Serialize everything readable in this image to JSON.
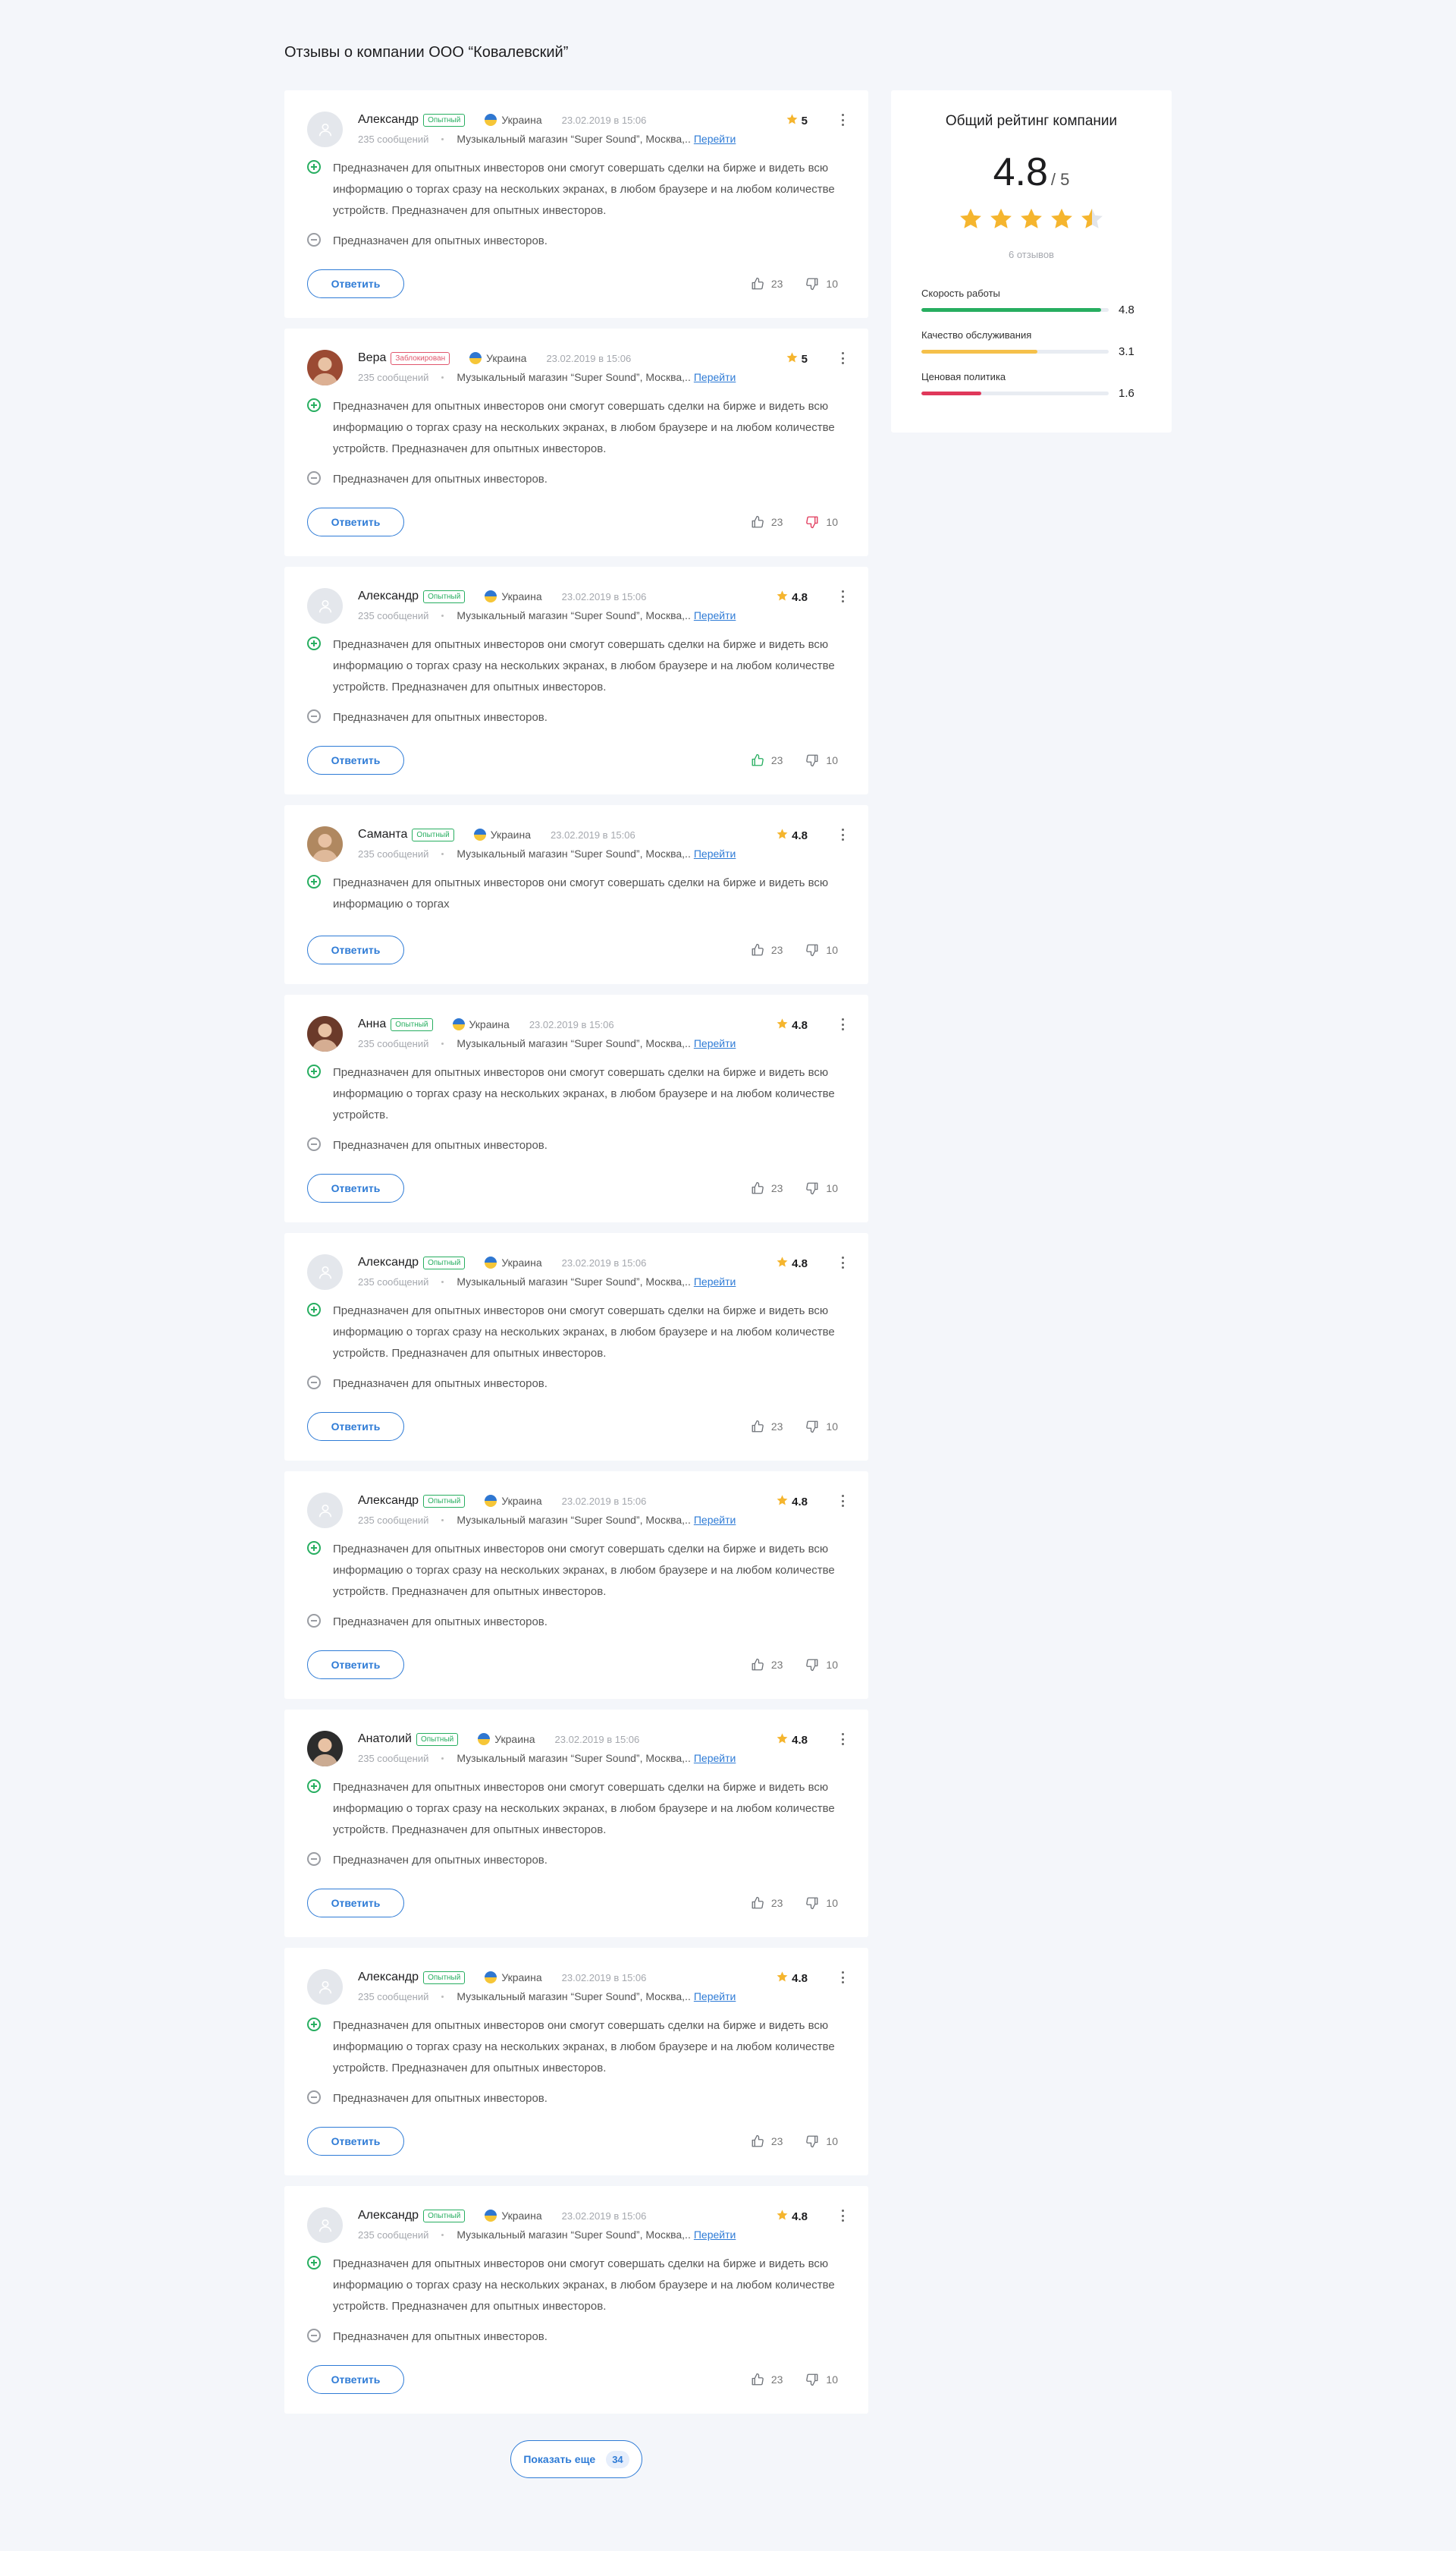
{
  "page_title": "Отзывы о компании ООО “Ковалевский”",
  "summary": {
    "title": "Общий рейтинг компании",
    "score": "4.8",
    "out_of": "/ 5",
    "star_value": 4.5,
    "reviews_count": "6 отзывов",
    "metrics": [
      {
        "label": "Скорость работы",
        "value": "4.8",
        "fraction": 0.96,
        "color": "#27ae60"
      },
      {
        "label": "Качество обслуживания",
        "value": "3.1",
        "fraction": 0.62,
        "color": "#f5c04a"
      },
      {
        "label": "Ценовая политика",
        "value": "1.6",
        "fraction": 0.32,
        "color": "#e0385a"
      }
    ]
  },
  "reply_label": "Ответить",
  "show_more": {
    "label": "Показать еще",
    "count": "34"
  },
  "colors": {
    "accent": "#2e7bd6",
    "positive": "#27ae60",
    "negative": "#e0385a",
    "star": "#f5b52e"
  },
  "reviews": [
    {
      "name": "Александр",
      "badge": "Опытный",
      "country": "Украина",
      "date": "23.02.2019 в 15:06",
      "messages": "235 сообщений",
      "shop": "Музыкальный магазин “Super Sound”, Москва,..",
      "link": "Перейти",
      "rating": "5",
      "pros": "Предназначен для опытных инвесторов они смогут совершать сделки на бирже и видеть всю информацию о торгах сразу на нескольких экранах, в любом браузере и на любом количестве устройств. Предназначен для опытных инвесторов.",
      "cons": "Предназначен для опытных инвесторов.",
      "likes": "23",
      "dislikes": "10"
    },
    {
      "name": "Вера",
      "badge": "Заблокирован",
      "country": "Украина",
      "date": "23.02.2019 в 15:06",
      "messages": "235 сообщений",
      "shop": "Музыкальный магазин “Super Sound”, Москва,..",
      "link": "Перейти",
      "rating": "5",
      "pros": "Предназначен для опытных инвесторов они смогут совершать сделки на бирже и видеть всю информацию о торгах сразу на нескольких экранах, в любом браузере и на любом количестве устройств. Предназначен для опытных инвесторов.",
      "cons": "Предназначен для опытных инвесторов.",
      "likes": "23",
      "dislikes": "10"
    },
    {
      "name": "Александр",
      "badge": "Опытный",
      "country": "Украина",
      "date": "23.02.2019 в 15:06",
      "messages": "235 сообщений",
      "shop": "Музыкальный магазин “Super Sound”, Москва,..",
      "link": "Перейти",
      "rating": "4.8",
      "pros": "Предназначен для опытных инвесторов они смогут совершать сделки на бирже и видеть всю информацию о торгах сразу на нескольких экранах, в любом браузере и на любом количестве устройств. Предназначен для опытных инвесторов.",
      "cons": "Предназначен для опытных инвесторов.",
      "likes": "23",
      "dislikes": "10"
    },
    {
      "name": "Саманта",
      "badge": "Опытный",
      "country": "Украина",
      "date": "23.02.2019 в 15:06",
      "messages": "235 сообщений",
      "shop": "Музыкальный магазин “Super Sound”, Москва,..",
      "link": "Перейти",
      "rating": "4.8",
      "pros": "Предназначен для опытных инвесторов они смогут совершать сделки на бирже и видеть всю информацию о торгах",
      "likes": "23",
      "dislikes": "10"
    },
    {
      "name": "Анна",
      "badge": "Опытный",
      "country": "Украина",
      "date": "23.02.2019 в 15:06",
      "messages": "235 сообщений",
      "shop": "Музыкальный магазин “Super Sound”, Москва,..",
      "link": "Перейти",
      "rating": "4.8",
      "pros": "Предназначен для опытных инвесторов они смогут совершать сделки на бирже и видеть всю информацию о торгах сразу на нескольких экранах, в любом браузере и на любом количестве устройств.",
      "cons": "Предназначен для опытных инвесторов.",
      "likes": "23",
      "dislikes": "10"
    },
    {
      "name": "Александр",
      "badge": "Опытный",
      "country": "Украина",
      "date": "23.02.2019 в 15:06",
      "messages": "235 сообщений",
      "shop": "Музыкальный магазин “Super Sound”, Москва,..",
      "link": "Перейти",
      "rating": "4.8",
      "pros": "Предназначен для опытных инвесторов они смогут совершать сделки на бирже и видеть всю информацию о торгах сразу на нескольких экранах, в любом браузере и на любом количестве устройств. Предназначен для опытных инвесторов.",
      "cons": "Предназначен для опытных инвесторов.",
      "likes": "23",
      "dislikes": "10"
    },
    {
      "name": "Александр",
      "badge": "Опытный",
      "country": "Украина",
      "date": "23.02.2019 в 15:06",
      "messages": "235 сообщений",
      "shop": "Музыкальный магазин “Super Sound”, Москва,..",
      "link": "Перейти",
      "rating": "4.8",
      "pros": "Предназначен для опытных инвесторов они смогут совершать сделки на бирже и видеть всю информацию о торгах сразу на нескольких экранах, в любом браузере и на любом количестве устройств. Предназначен для опытных инвесторов.",
      "cons": "Предназначен для опытных инвесторов.",
      "likes": "23",
      "dislikes": "10"
    },
    {
      "name": "Анатолий",
      "badge": "Опытный",
      "country": "Украина",
      "date": "23.02.2019 в 15:06",
      "messages": "235 сообщений",
      "shop": "Музыкальный магазин “Super Sound”, Москва,..",
      "link": "Перейти",
      "rating": "4.8",
      "pros": "Предназначен для опытных инвесторов они смогут совершать сделки на бирже и видеть всю информацию о торгах сразу на нескольких экранах, в любом браузере и на любом количестве устройств. Предназначен для опытных инвесторов.",
      "cons": "Предназначен для опытных инвесторов.",
      "likes": "23",
      "dislikes": "10"
    },
    {
      "name": "Александр",
      "badge": "Опытный",
      "country": "Украина",
      "date": "23.02.2019 в 15:06",
      "messages": "235 сообщений",
      "shop": "Музыкальный магазин “Super Sound”, Москва,..",
      "link": "Перейти",
      "rating": "4.8",
      "pros": "Предназначен для опытных инвесторов они смогут совершать сделки на бирже и видеть всю информацию о торгах сразу на нескольких экранах, в любом браузере и на любом количестве устройств. Предназначен для опытных инвесторов.",
      "cons": "Предназначен для опытных инвесторов.",
      "likes": "23",
      "dislikes": "10"
    },
    {
      "name": "Александр",
      "badge": "Опытный",
      "country": "Украина",
      "date": "23.02.2019 в 15:06",
      "messages": "235 сообщений",
      "shop": "Музыкальный магазин “Super Sound”, Москва,..",
      "link": "Перейти",
      "rating": "4.8",
      "pros": "Предназначен для опытных инвесторов они смогут совершать сделки на бирже и видеть всю информацию о торгах сразу на нескольких экранах, в любом браузере и на любом количестве устройств. Предназначен для опытных инвесторов.",
      "cons": "Предназначен для опытных инвесторов.",
      "likes": "23",
      "dislikes": "10"
    }
  ]
}
